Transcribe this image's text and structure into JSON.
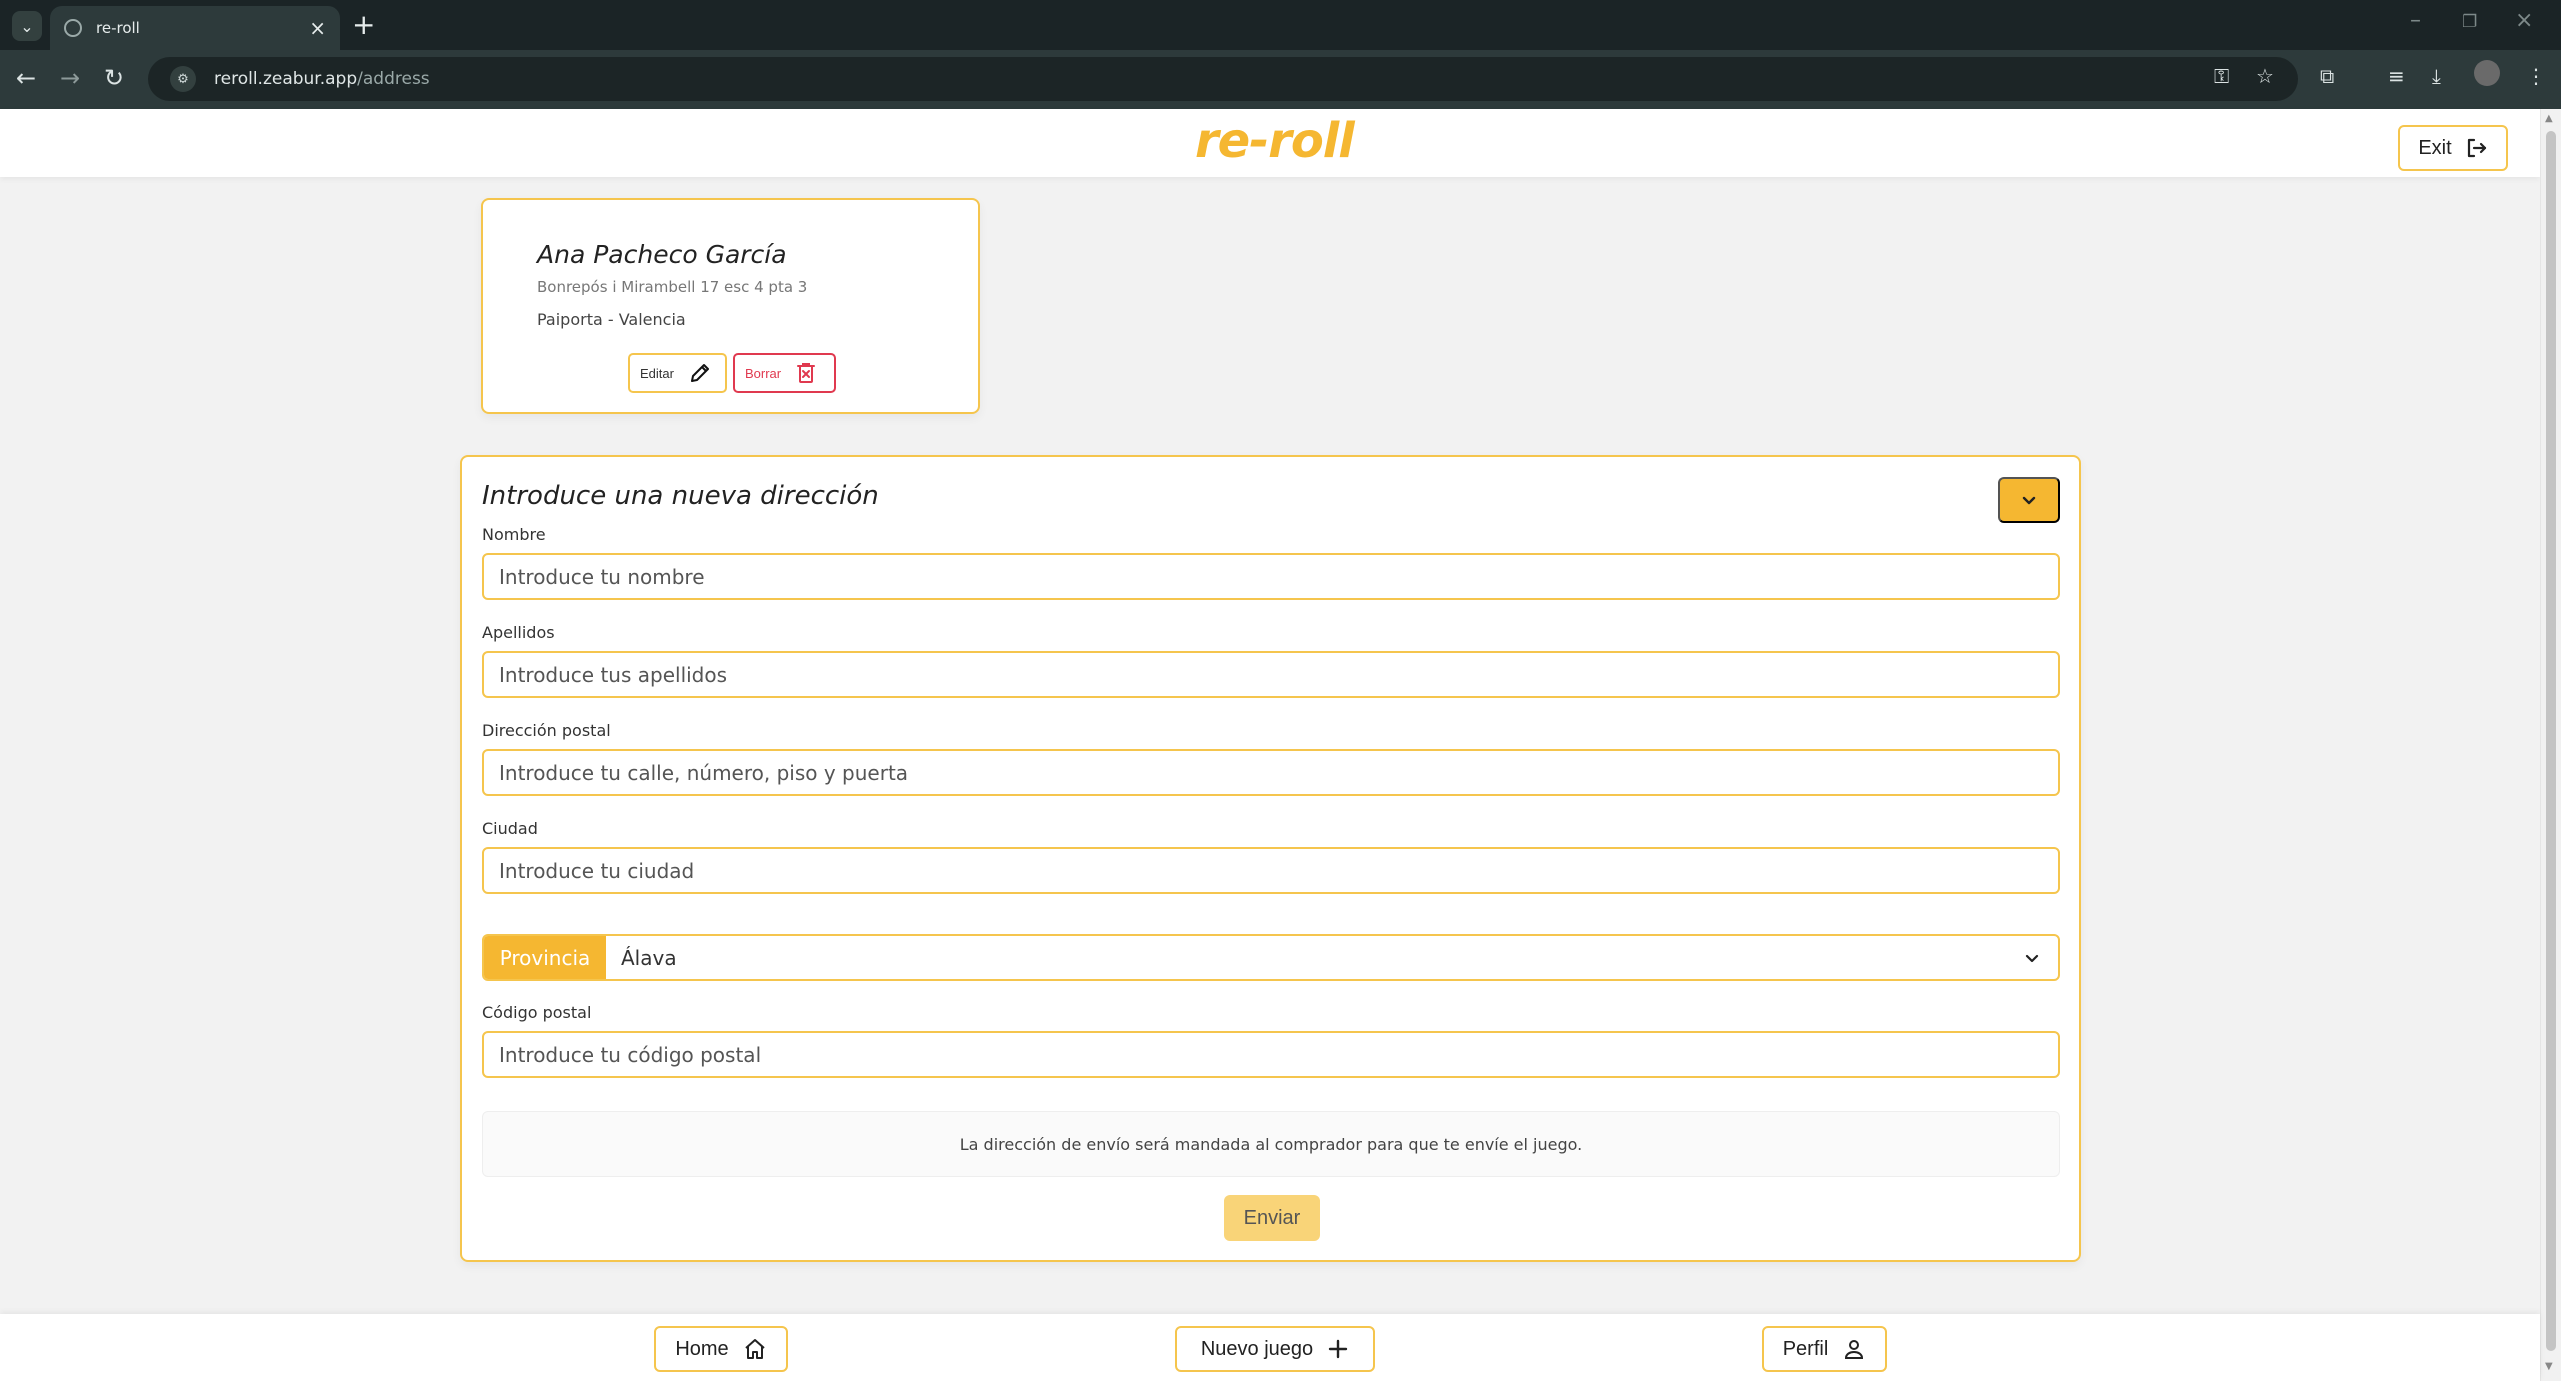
{
  "browser": {
    "tab_title": "re-roll",
    "url_host": "reroll.zeabur.app",
    "url_path": "/address"
  },
  "header": {
    "logo": "re-roll",
    "exit_label": "Exit"
  },
  "address_card": {
    "name": "Ana Pacheco García",
    "street": "Bonrepós i Mirambell 17 esc 4 pta 3",
    "city": "Paiporta - Valencia",
    "edit_label": "Editar",
    "delete_label": "Borrar"
  },
  "form": {
    "title": "Introduce una nueva dirección",
    "fields": {
      "nombre": {
        "label": "Nombre",
        "placeholder": "Introduce tu nombre"
      },
      "apellidos": {
        "label": "Apellidos",
        "placeholder": "Introduce tus apellidos"
      },
      "direccion": {
        "label": "Dirección postal",
        "placeholder": "Introduce tu calle, número, piso y puerta"
      },
      "ciudad": {
        "label": "Ciudad",
        "placeholder": "Introduce tu ciudad"
      },
      "provincia": {
        "label": "Provincia",
        "selected": "Álava"
      },
      "codigo_postal": {
        "label": "Código postal",
        "placeholder": "Introduce tu código postal"
      }
    },
    "notice": "La dirección de envío será mandada al comprador para que te envíe el juego.",
    "submit_label": "Enviar"
  },
  "bottom_nav": {
    "home": "Home",
    "new_game": "Nuevo juego",
    "profile": "Perfil"
  },
  "colors": {
    "accent": "#f5b731",
    "accent_border": "#f5c54d",
    "danger": "#e0394f"
  }
}
